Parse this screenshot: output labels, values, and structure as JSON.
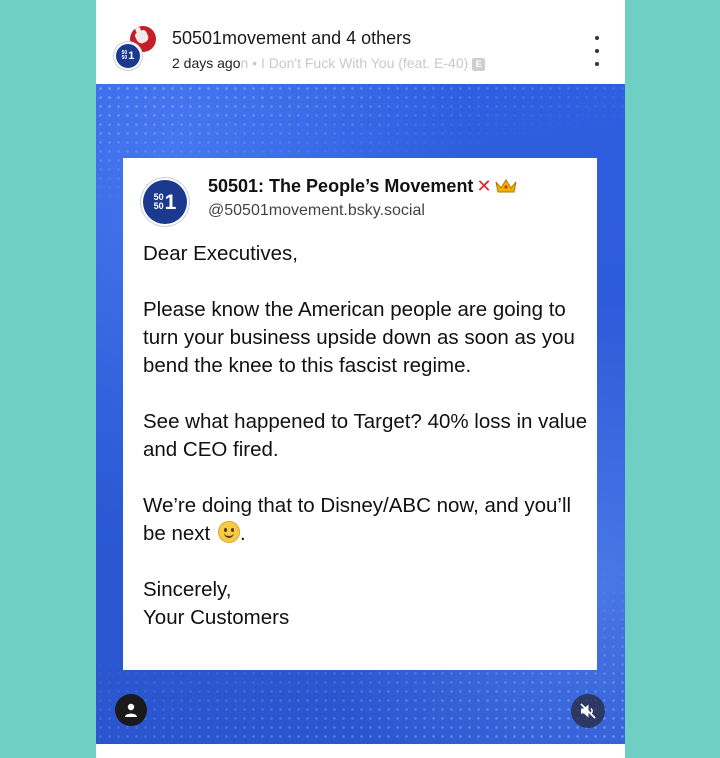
{
  "header": {
    "account_name": "50501movement",
    "and_text": " and ",
    "others_label": "4 others",
    "timestamp": "2 days ago",
    "song_title": "n • I Don't Fuck With You (feat. E-40)",
    "explicit_badge": "E",
    "icons": {
      "more": "more-vertical-icon"
    }
  },
  "logo": {
    "top": "50",
    "bottom": "50",
    "big": "1"
  },
  "card": {
    "display_name": "50501: The People’s Movement",
    "x_mark": "✕",
    "handle": "@50501movement.bsky.social",
    "paragraphs": [
      "Dear Executives,",
      "Please know the American people are going to turn your business upside down as soon as you bend the knee to this fascist regime.",
      "See what happened to Target? 40% loss in value and CEO fired."
    ],
    "para4_text": "We’re doing that to Disney/ABC now, and you’ll be next ",
    "para4_end": ".",
    "signoff_line1": "Sincerely,",
    "signoff_line2": "Your Customers",
    "icons": {
      "crown": "crown-icon",
      "smile": "slightly-smiling-face-icon"
    }
  },
  "controls": {
    "icons": {
      "profile": "person-icon",
      "mute": "volume-muted-icon"
    }
  },
  "colors": {
    "background": "#6fcfc5",
    "media_blue": "#2c59d6",
    "logo_navy": "#1b3a8f",
    "x_red": "#e0242c"
  }
}
